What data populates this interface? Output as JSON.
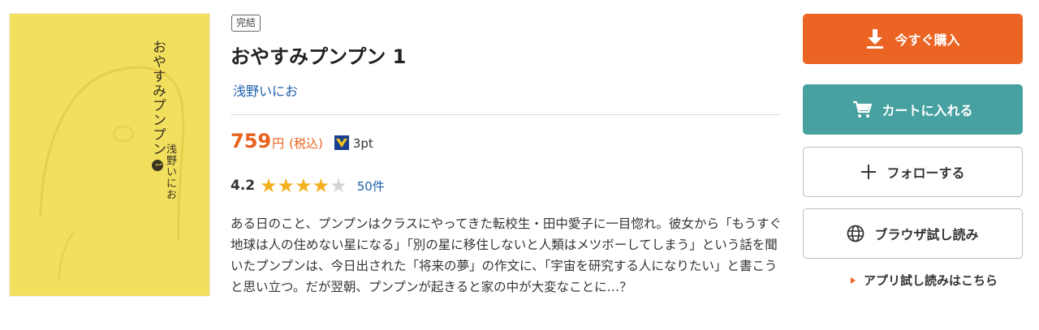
{
  "cover": {
    "title_vertical": "おやすみプンプン",
    "volume_mark": "1",
    "author_vertical": "浅野いにお"
  },
  "book": {
    "status_badge": "完結",
    "title": "おやすみプンプン 1",
    "author": "浅野いにお",
    "price": "759",
    "price_unit": "円",
    "tax_label": "(税込)",
    "points": "3pt",
    "rating": "4.2",
    "rating_value": 4.2,
    "rating_max": 5,
    "review_count": "50件",
    "description": "ある日のこと、プンプンはクラスにやってきた転校生・田中愛子に一目惚れ。彼女から「もうすぐ地球は人の住めない星になる」「別の星に移住しないと人類はメツボーしてしまう」という話を聞いたプンプンは、今日出された「将来の夢」の作文に、「宇宙を研究する人になりたい」と書こうと思い立つ。だが翌朝、プンプンが起きると家の中が大変なことに…？"
  },
  "actions": {
    "buy_label": "今すぐ購入",
    "cart_label": "カートに入れる",
    "follow_label": "フォローする",
    "preview_label": "ブラウザ試し読み",
    "app_preview_label": "アプリ試し読みはこちら"
  },
  "colors": {
    "accent_orange": "#ec6424",
    "cart_teal": "#47a1a0",
    "link_blue": "#1f5fae",
    "star_gold": "#f2b01e",
    "cover_yellow": "#f3df5e"
  },
  "icons": {
    "buy": "download-icon",
    "cart": "cart-icon",
    "follow": "plus-icon",
    "preview": "globe-icon",
    "points": "v-point-icon",
    "app_link": "triangle-right-icon"
  }
}
